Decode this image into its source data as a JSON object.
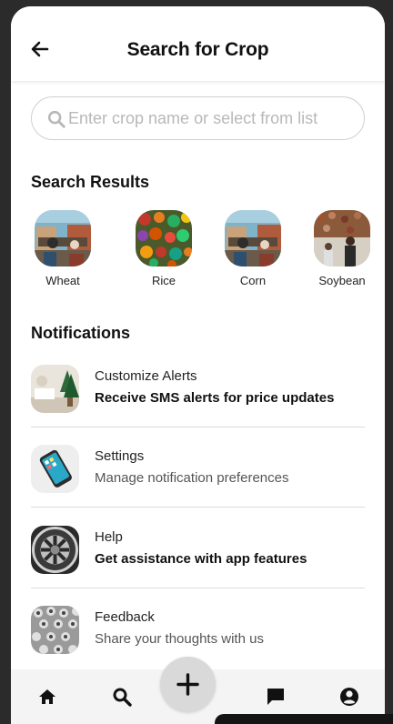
{
  "header": {
    "title": "Search for Crop"
  },
  "search": {
    "placeholder": "Enter crop name or select from list"
  },
  "results": {
    "heading": "Search Results",
    "crops": [
      {
        "label": "Wheat",
        "image": "market-stall"
      },
      {
        "label": "Rice",
        "image": "vegetables"
      },
      {
        "label": "Corn",
        "image": "market-stall"
      },
      {
        "label": "Soybean",
        "image": "market-shop"
      }
    ]
  },
  "notifications": {
    "heading": "Notifications",
    "items": [
      {
        "title": "Customize Alerts",
        "subtitle": "Receive SMS alerts for price updates",
        "bold": true,
        "image": "plant-desk"
      },
      {
        "title": "Settings",
        "subtitle": "Manage notification preferences",
        "bold": false,
        "image": "smartphone"
      },
      {
        "title": "Help",
        "subtitle": "Get assistance with app features",
        "bold": true,
        "image": "wheel-rim"
      },
      {
        "title": "Feedback",
        "subtitle": "Share your thoughts with us",
        "bold": false,
        "image": "text-pattern"
      }
    ]
  },
  "nav": {
    "items": [
      "home-icon",
      "search-icon",
      "add-icon",
      "chat-icon",
      "account-icon"
    ]
  },
  "colors": {
    "background": "#ffffff",
    "frame": "#2b2b2b",
    "divider": "#dcdcdc",
    "placeholder": "#b8b8b8",
    "fab": "#d9d9d9"
  }
}
